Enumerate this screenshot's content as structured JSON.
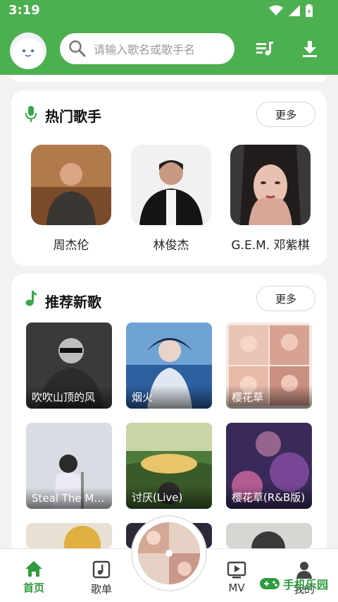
{
  "status": {
    "time": "3:19"
  },
  "search": {
    "placeholder": "请输入歌名或歌手名"
  },
  "hot_artists": {
    "title": "热门歌手",
    "more": "更多",
    "items": [
      {
        "name": "周杰伦"
      },
      {
        "name": "林俊杰"
      },
      {
        "name": "G.E.M. 邓紫棋"
      }
    ]
  },
  "new_songs": {
    "title": "推荐新歌",
    "more": "更多",
    "items": [
      {
        "title": "吹吹山顶的风"
      },
      {
        "title": "烟火"
      },
      {
        "title": "樱花草"
      },
      {
        "title": "Steal The Mo..."
      },
      {
        "title": "讨厌(Live)"
      },
      {
        "title": "樱花草(R&B版)"
      }
    ]
  },
  "nav": {
    "home": "首页",
    "playlist": "歌单",
    "mv": "MV",
    "mine": "我的"
  },
  "watermark": {
    "text": "手机乐园"
  },
  "colors": {
    "brand": "#4caf50",
    "active": "#2e9b3e"
  }
}
